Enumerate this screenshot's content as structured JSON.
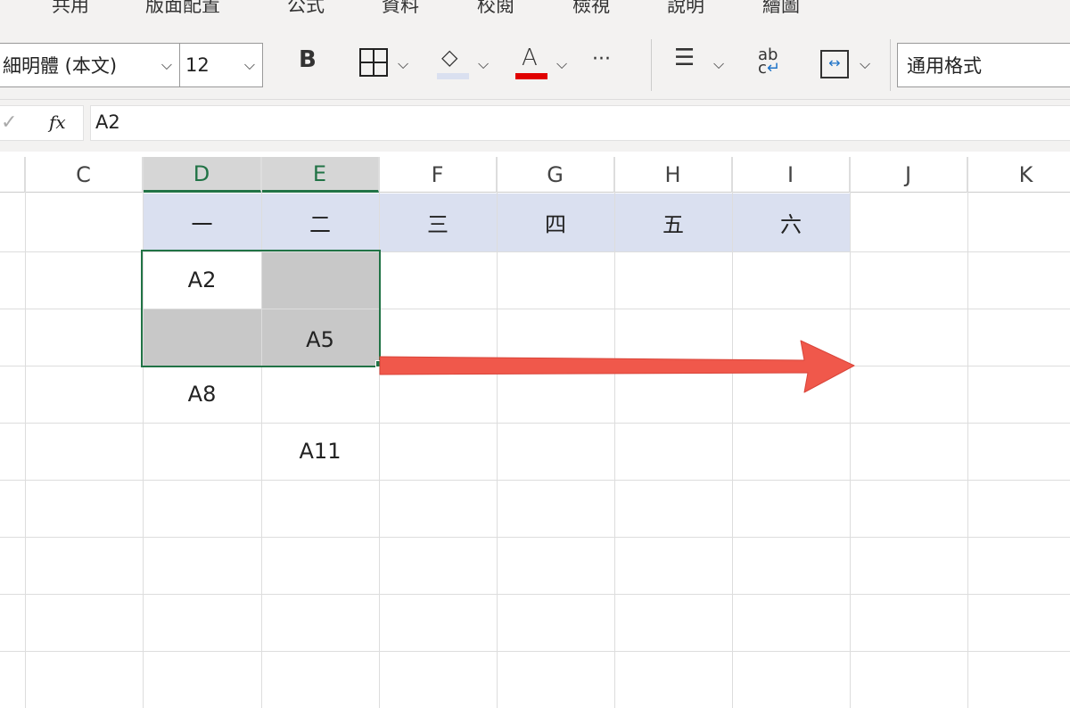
{
  "menu_tabs": [
    "共用",
    "版面配置",
    "公式",
    "資料",
    "校閱",
    "檢視",
    "說明",
    "繪圖"
  ],
  "toolbar": {
    "font_name": "細明體 (本文)",
    "font_size": "12",
    "bold": "B",
    "font_color_letter": "A",
    "more": "···",
    "number_format": "通用格式",
    "fill_color": "#dae0f0",
    "font_color": "#e00000"
  },
  "formula_bar": {
    "fx": "fx",
    "value": "A2"
  },
  "columns": [
    "C",
    "D",
    "E",
    "F",
    "G",
    "H",
    "I",
    "J",
    "K"
  ],
  "header_row": [
    "一",
    "二",
    "三",
    "四",
    "五",
    "六"
  ],
  "cells": {
    "D2": "A2",
    "E3": "A5",
    "D4": "A8",
    "E5": "A11"
  },
  "colors": {
    "selection": "#217346",
    "header_fill": "#dae0f0",
    "gray_fill": "#c8c8c8",
    "arrow": "#f0584b"
  }
}
